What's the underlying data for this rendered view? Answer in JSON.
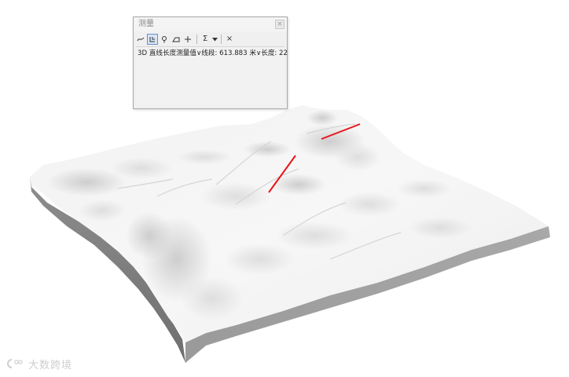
{
  "measure_window": {
    "title": "测量",
    "close_label": "×",
    "result_line": "3D 直线长度测量值∨线段: 613.883 米∨长度: 22",
    "tools": [
      {
        "icon": "measure-line-icon"
      },
      {
        "icon": "measure-area-icon"
      },
      {
        "icon": "measure-feature-icon"
      },
      {
        "icon": "measure-3d-icon"
      },
      {
        "icon": "add-point-icon"
      },
      {
        "icon": "sum-icon"
      },
      {
        "icon": "units-dropdown-icon"
      },
      {
        "icon": "clear-icon"
      }
    ],
    "clear_label": "×",
    "sum_label": "Σ"
  },
  "terrain": {
    "measure_line_color": "#e8141c",
    "measure_segments": 2
  },
  "watermark": {
    "text": "大数跨境"
  }
}
